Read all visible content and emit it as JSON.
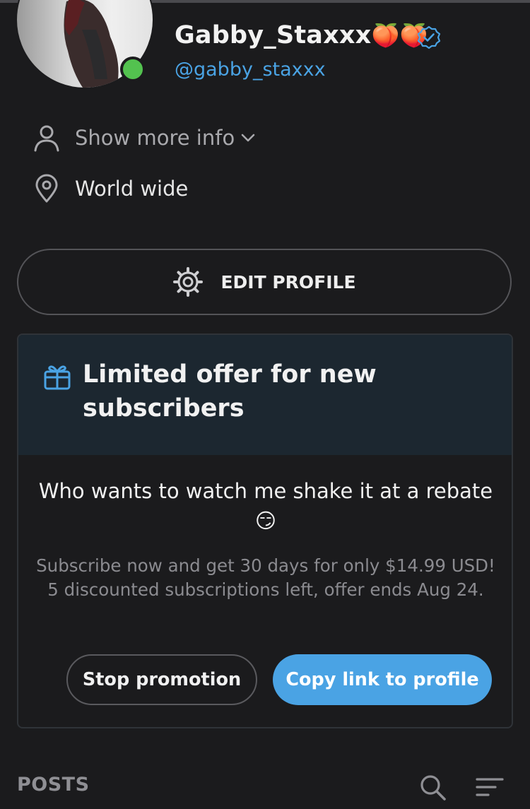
{
  "profile": {
    "name": "Gabby_Staxxx",
    "name_emoji": "🍑🍑",
    "handle": "@gabby_staxxx",
    "online": true,
    "verified_icon": "verified-check-icon"
  },
  "info": {
    "show_more_label": "Show more info",
    "location": "World wide"
  },
  "edit_profile": {
    "label": "EDIT PROFILE",
    "icon": "gear-icon"
  },
  "offer": {
    "icon": "gift-icon",
    "title": "Limited offer for new subscribers",
    "message": "Who wants to watch me shake it at a rebate 😏",
    "details_line1": "Subscribe now and get 30 days for only $14.99 USD!",
    "details_line2": "5 discounted subscriptions left, offer ends Aug 24.",
    "stop_label": "Stop promotion",
    "copy_label": "Copy link to profile"
  },
  "posts": {
    "label": "POSTS"
  },
  "colors": {
    "background": "#1b1b1d",
    "accent": "#4aa3e4",
    "online": "#53c24f",
    "offer_header": "#1c2730"
  }
}
